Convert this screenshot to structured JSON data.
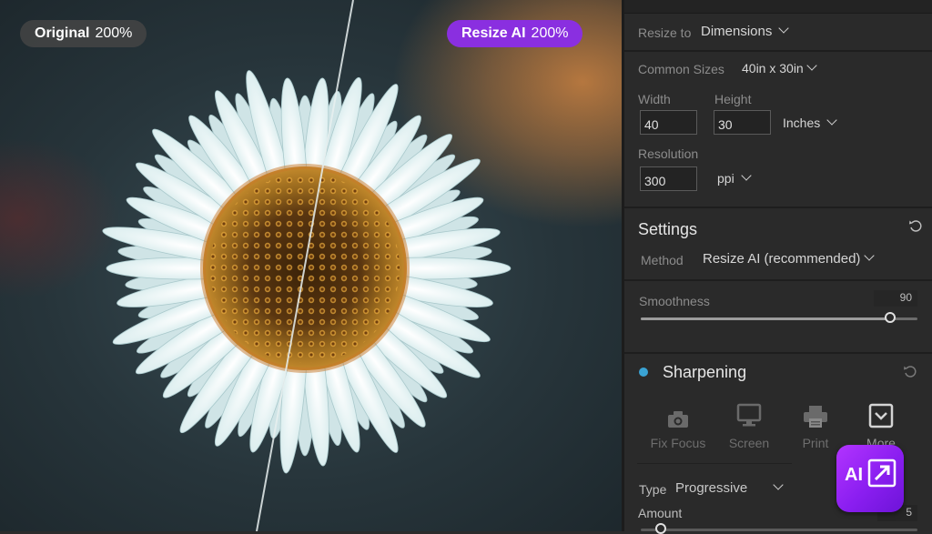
{
  "photo": {
    "badges": {
      "original": {
        "name": "Original",
        "zoom": "200%"
      },
      "resize": {
        "name": "Resize AI",
        "zoom": "200%"
      }
    }
  },
  "panel": {
    "resize_to": {
      "label": "Resize to",
      "value": "Dimensions"
    },
    "common_sizes": {
      "label": "Common Sizes",
      "value": "40in x 30in"
    },
    "width": {
      "label": "Width",
      "value": "40"
    },
    "height": {
      "label": "Height",
      "value": "30"
    },
    "unit": "Inches",
    "resolution": {
      "label": "Resolution",
      "value": "300",
      "unit": "ppi"
    },
    "settings": {
      "title": "Settings",
      "method_label": "Method",
      "method_value": "Resize AI (recommended)",
      "smoothness": {
        "label": "Smoothness",
        "value": "90",
        "fraction": 0.9
      }
    },
    "sharpening": {
      "title": "Sharpening",
      "presets": [
        {
          "label": "Fix Focus",
          "icon": "camera-icon"
        },
        {
          "label": "Screen",
          "icon": "monitor-icon"
        },
        {
          "label": "Print",
          "icon": "printer-icon"
        },
        {
          "label": "More",
          "icon": "chevron-down-box-icon"
        }
      ],
      "type_label": "Type",
      "type_value": "Progressive",
      "amount_label": "Amount",
      "amount_value": "5"
    }
  },
  "ai_badge": {
    "text": "AI",
    "icon": "resize-arrow-icon"
  },
  "colors": {
    "accent_purple": "#8a2fe0",
    "sharpening_dot": "#3aa3d4",
    "panel_bg": "#2a2a2a"
  }
}
